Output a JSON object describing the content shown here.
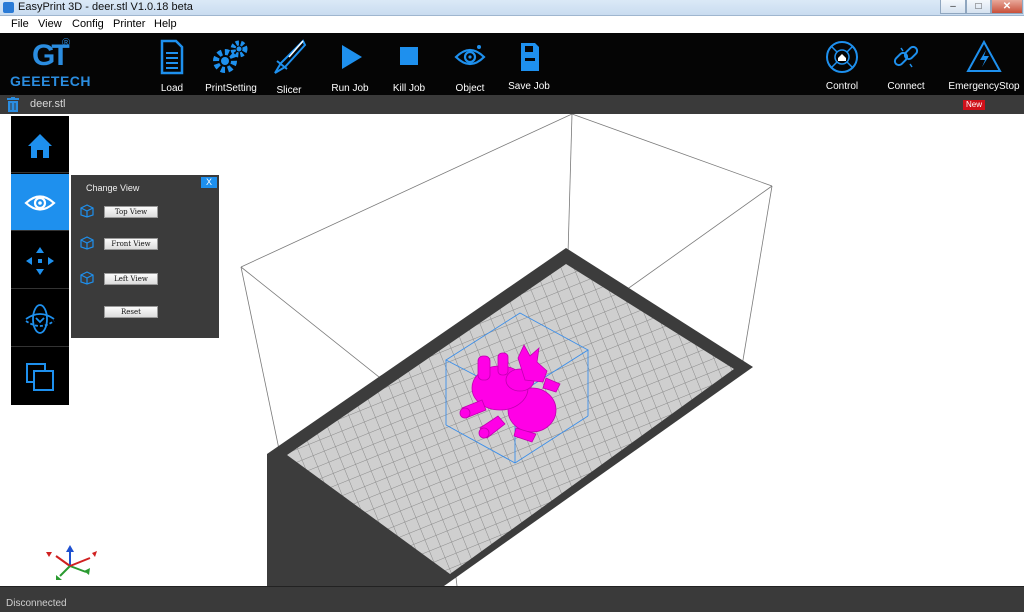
{
  "window": {
    "title": "EasyPrint 3D - deer.stl   V1.0.18 beta",
    "min": "–",
    "max": "□",
    "close": "✕"
  },
  "menu": [
    "File",
    "View",
    "Config",
    "Printer",
    "Help"
  ],
  "logo": {
    "mark": "GT",
    "registered": "®",
    "brand": "GEEETECH"
  },
  "toolbar": {
    "load": "Load",
    "print_setting": "PrintSetting",
    "slicer": "Slicer",
    "run_job": "Run Job",
    "kill_job": "Kill Job",
    "object": "Object",
    "save_job": "Save Job",
    "control": "Control",
    "connect": "Connect",
    "emergency_stop": "EmergencyStop"
  },
  "tabbar": {
    "file_name": "deer.stl",
    "new_badge": "New"
  },
  "change_view": {
    "title": "Change View",
    "close": "X",
    "top_view": "Top View",
    "front_view": "Front View",
    "left_view": "Left View",
    "reset": "Reset"
  },
  "status": {
    "text": "Disconnected"
  },
  "colors": {
    "accent": "#1e90ee",
    "model": "#ff00e6",
    "toolbar_bg": "#050505",
    "panel_bg": "#3b3b3b",
    "bed_border": "#3c3c3c",
    "bed_fill": "#cfcfcf"
  },
  "icons": [
    "load-icon",
    "gear-icon",
    "slicer-icon",
    "play-icon",
    "stop-icon",
    "eye-icon",
    "save-icon",
    "home-icon",
    "link-icon",
    "warning-icon",
    "trash-icon",
    "cube-icon",
    "move-icon",
    "rotate-icon",
    "scale-icon",
    "axis-icon"
  ]
}
